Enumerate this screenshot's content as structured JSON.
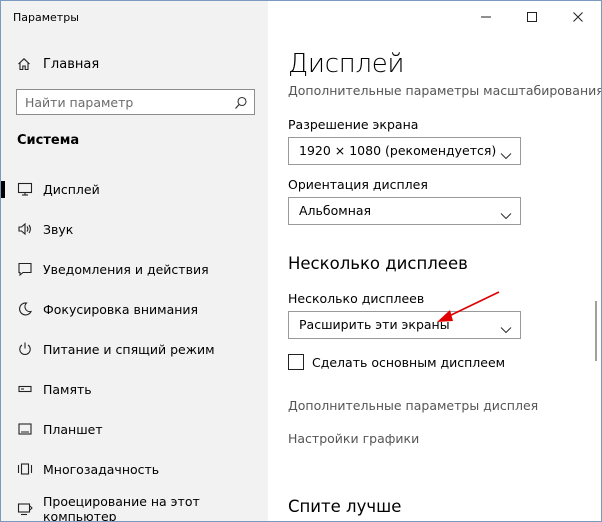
{
  "window": {
    "title": "Параметры",
    "accent_arrow_color": "#e00000"
  },
  "sidebar": {
    "home_label": "Главная",
    "search_placeholder": "Найти параметр",
    "section_title": "Система",
    "items": [
      {
        "label": "Дисплей",
        "icon": "monitor-icon",
        "active": true
      },
      {
        "label": "Звук",
        "icon": "speaker-icon"
      },
      {
        "label": "Уведомления и действия",
        "icon": "notification-icon"
      },
      {
        "label": "Фокусировка внимания",
        "icon": "moon-icon"
      },
      {
        "label": "Питание и спящий режим",
        "icon": "power-icon"
      },
      {
        "label": "Память",
        "icon": "storage-icon"
      },
      {
        "label": "Планшет",
        "icon": "tablet-icon"
      },
      {
        "label": "Многозадачность",
        "icon": "multitasking-icon"
      },
      {
        "label": "Проецирование на этот компьютер",
        "icon": "projection-icon"
      }
    ]
  },
  "main": {
    "page_title": "Дисплей",
    "advanced_scaling_link": "Дополнительные параметры масштабирования",
    "resolution_label": "Разрешение экрана",
    "resolution_value": "1920 × 1080 (рекомендуется)",
    "orientation_label": "Ориентация дисплея",
    "orientation_value": "Альбомная",
    "multi_heading": "Несколько дисплеев",
    "multi_label": "Несколько дисплеев",
    "multi_value": "Расширить эти экраны",
    "main_display_checkbox": "Сделать основным дисплеем",
    "main_display_checked": false,
    "advanced_display_link": "Дополнительные параметры дисплея",
    "graphics_link": "Настройки графики",
    "sleep_heading": "Спите лучше"
  }
}
